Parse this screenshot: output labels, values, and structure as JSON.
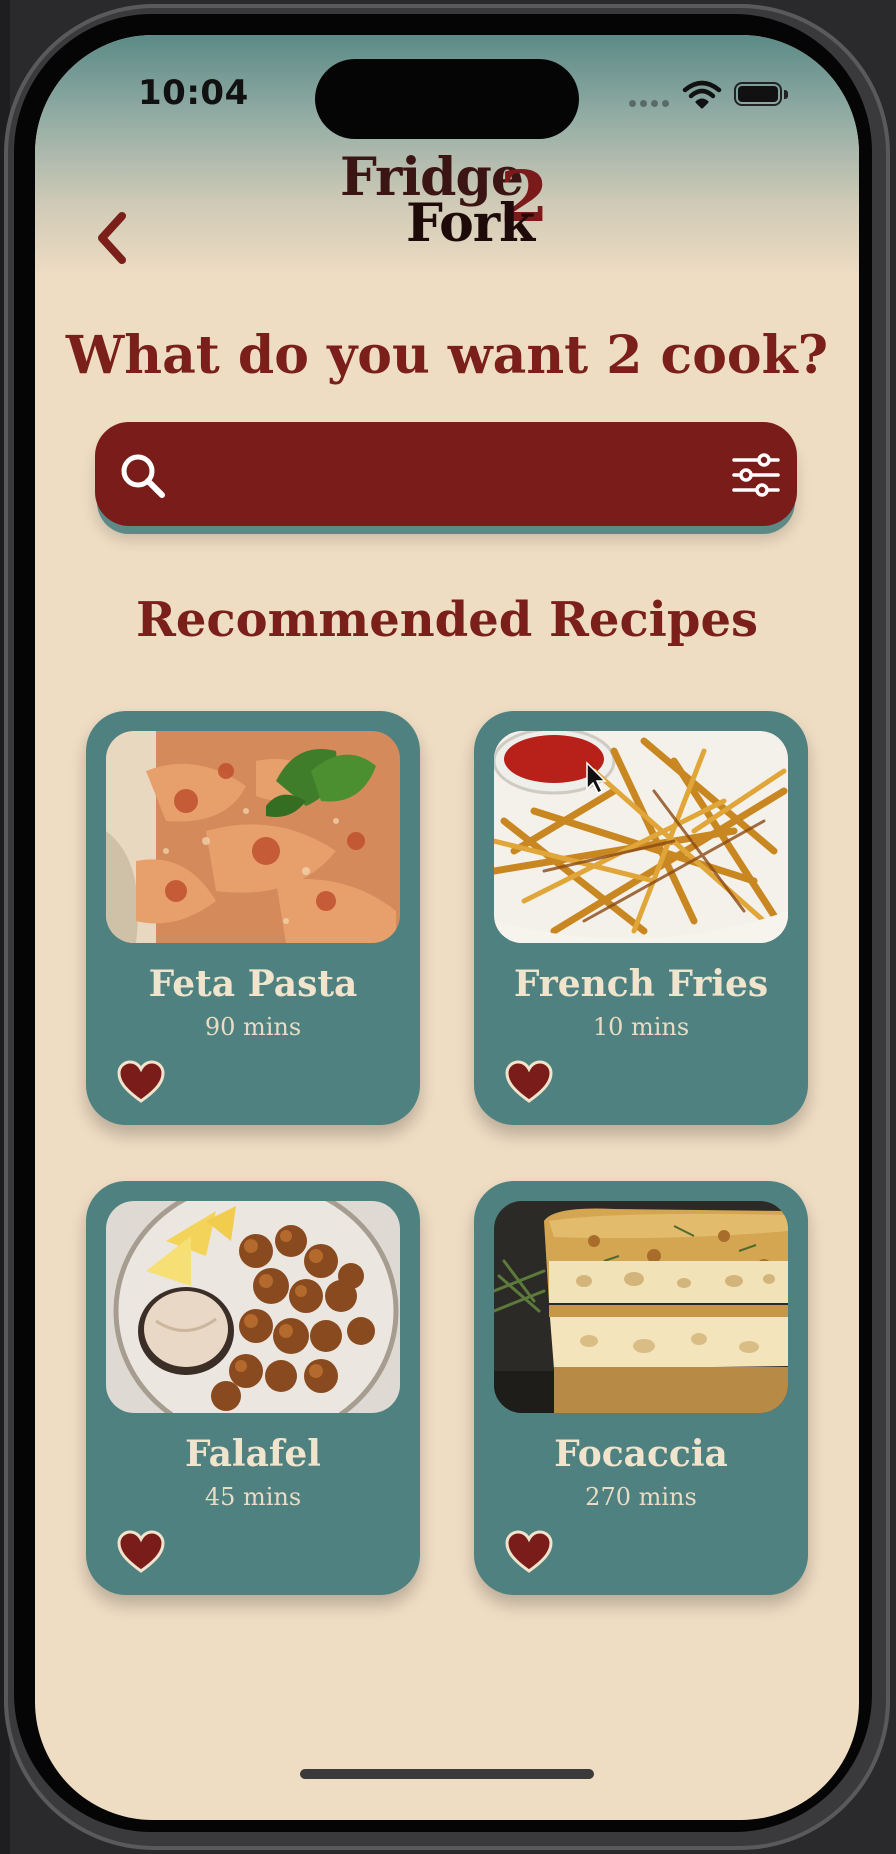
{
  "status_bar": {
    "time": "10:04"
  },
  "logo": {
    "line1": "Fridge",
    "line2": "Fork",
    "numeral": "2"
  },
  "headline": "What do you want 2 cook?",
  "search": {
    "placeholder": ""
  },
  "section_title": "Recommended Recipes",
  "recipes": [
    {
      "name": "Feta Pasta",
      "time": "90 mins",
      "favorited": true
    },
    {
      "name": "French Fries",
      "time": "10 mins",
      "favorited": true
    },
    {
      "name": "Falafel",
      "time": "45 mins",
      "favorited": true
    },
    {
      "name": "Focaccia",
      "time": "270 mins",
      "favorited": true
    }
  ],
  "colors": {
    "background": "#eedcc3",
    "primary_red": "#7a1c19",
    "card_teal": "#4e8180",
    "header_teal": "#5c8a87",
    "card_text": "#f1e4cc"
  },
  "icons": {
    "back": "chevron-left-icon",
    "search": "search-icon",
    "filter": "sliders-icon",
    "favorite": "heart-icon"
  }
}
